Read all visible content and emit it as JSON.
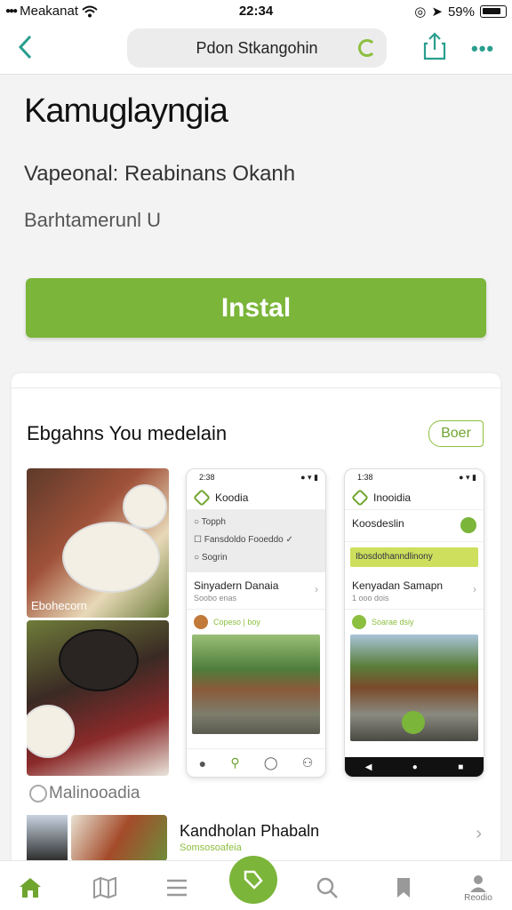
{
  "status_bar": {
    "carrier": "Meakanat",
    "time": "22:34",
    "battery": "59%"
  },
  "nav": {
    "url_text": "Pdon Stkangohin"
  },
  "header": {
    "title": "Kamuglayngia",
    "subtitle": "Vapeonal: Reabinans Okanh",
    "meta": "Barhtamerunl U"
  },
  "install_label": "Instal",
  "section": {
    "title": "Ebgahns You medelain",
    "see_label": "Boer"
  },
  "food": {
    "caption1": "Ebohecorn",
    "caption2": "Malinooadia"
  },
  "phone1": {
    "time": "2:38",
    "app_name": "Koodia",
    "menu": [
      "Topph",
      "Fansdoldo Fooeddo",
      "Sogrin"
    ],
    "item_title": "Sinyadern Danaia",
    "item_sub": "Soobo enas",
    "user": "Copeso | boy"
  },
  "phone2": {
    "time": "1:38",
    "app_name": "Inooidia",
    "item1": "Koosdeslin",
    "highlight": "Ibosdothanndlinony",
    "item_title": "Kenyadan Samapn",
    "item_sub": "1 ooo  dois",
    "user": "Soarae dsiy"
  },
  "list_item": {
    "title": "Kandholan Phabaln",
    "subtitle": "Somsosoafeia"
  },
  "tabbar": {
    "profile_label": "Reodio"
  },
  "colors": {
    "accent_green": "#7bb53a",
    "teal": "#2a9e8e"
  }
}
